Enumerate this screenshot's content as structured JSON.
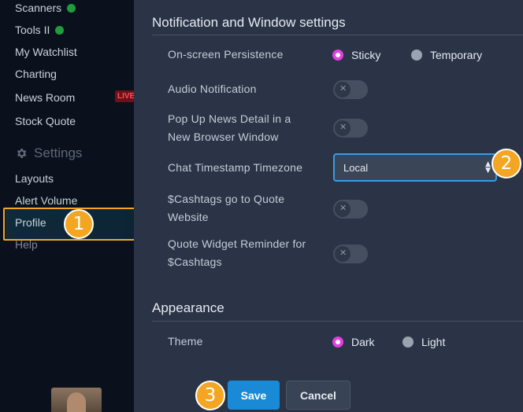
{
  "sidebar": {
    "items": [
      {
        "label": "Scanners",
        "status": "green"
      },
      {
        "label": "Tools II",
        "status": "green"
      },
      {
        "label": "My Watchlist"
      },
      {
        "label": "Charting"
      },
      {
        "label": "News Room",
        "badge": "LIVE"
      },
      {
        "label": "Stock Quote"
      }
    ],
    "settings_header": "Settings",
    "settings_items": [
      {
        "label": "Layouts"
      },
      {
        "label": "Alert Volume"
      },
      {
        "label": "Profile",
        "selected": true
      },
      {
        "label": "Help"
      }
    ]
  },
  "notification": {
    "title": "Notification and Window settings",
    "persistence": {
      "label": "On-screen Persistence",
      "options": [
        "Sticky",
        "Temporary"
      ],
      "selected": "Sticky"
    },
    "audio": {
      "label": "Audio Notification",
      "enabled": false
    },
    "popup": {
      "label_line1": "Pop Up News Detail in a",
      "label_line2": "New Browser Window",
      "enabled": false
    },
    "timezone": {
      "label": "Chat Timestamp Timezone",
      "value": "Local"
    },
    "cashtags": {
      "label_line1": "$Cashtags go to Quote",
      "label_line2": "Website",
      "enabled": false
    },
    "reminder": {
      "label_line1": "Quote Widget Reminder for",
      "label_line2": "$Cashtags",
      "enabled": false
    }
  },
  "appearance": {
    "title": "Appearance",
    "theme": {
      "label": "Theme",
      "options": [
        "Dark",
        "Light"
      ],
      "selected": "Dark"
    }
  },
  "actions": {
    "save": "Save",
    "cancel": "Cancel"
  },
  "annotations": [
    "1",
    "2",
    "3"
  ],
  "colors": {
    "accent": "#1a8ad6",
    "radio_selected": "#e040e0",
    "highlight": "#f4a623",
    "panel": "#2a3446",
    "sidebar": "#0a111d"
  }
}
